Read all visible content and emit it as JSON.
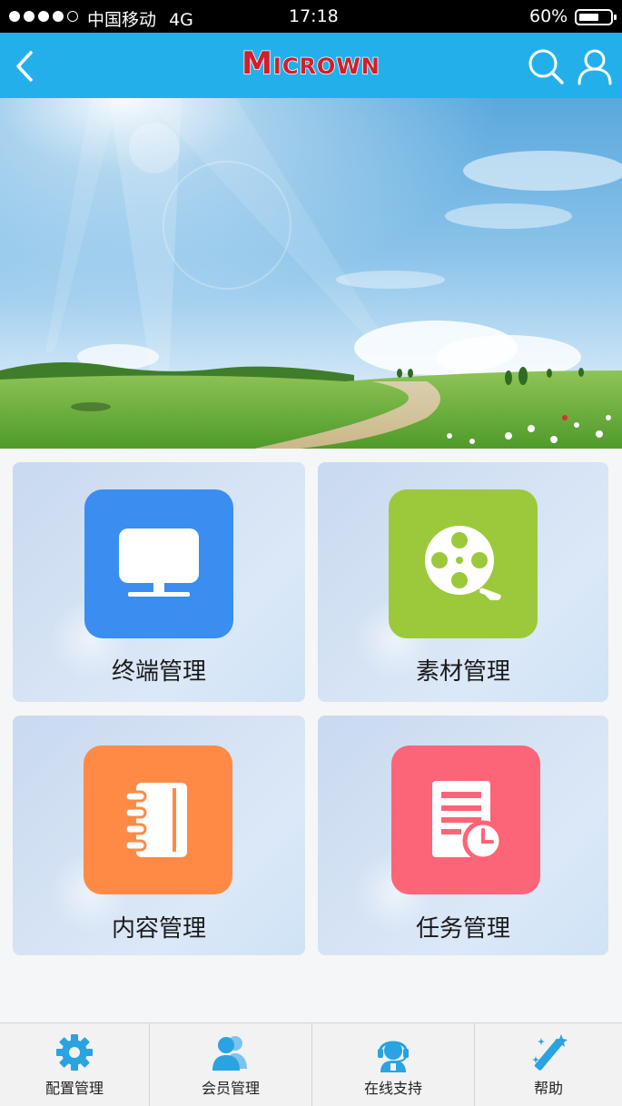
{
  "status_bar": {
    "carrier": "中国移动",
    "network": "4G",
    "time": "17:18",
    "battery": "60%"
  },
  "header": {
    "logo_text": "Micrown",
    "back_icon": "chevron-left-icon",
    "search_icon": "search-icon",
    "user_icon": "user-icon",
    "background_color": "#23b0ea",
    "logo_color": "#d21e2b"
  },
  "tiles": [
    {
      "label": "终端管理",
      "icon": "monitor-icon",
      "color": "#3a8ef0"
    },
    {
      "label": "素材管理",
      "icon": "film-reel-icon",
      "color": "#9cc93b"
    },
    {
      "label": "内容管理",
      "icon": "notebook-icon",
      "color": "#ff8a45"
    },
    {
      "label": "任务管理",
      "icon": "task-schedule-icon",
      "color": "#fc6478"
    }
  ],
  "tab_bar": [
    {
      "label": "配置管理",
      "icon": "gear-icon"
    },
    {
      "label": "会员管理",
      "icon": "members-icon"
    },
    {
      "label": "在线支持",
      "icon": "support-agent-icon"
    },
    {
      "label": "帮助",
      "icon": "magic-wand-icon"
    }
  ],
  "accent_color": "#29a3e2"
}
